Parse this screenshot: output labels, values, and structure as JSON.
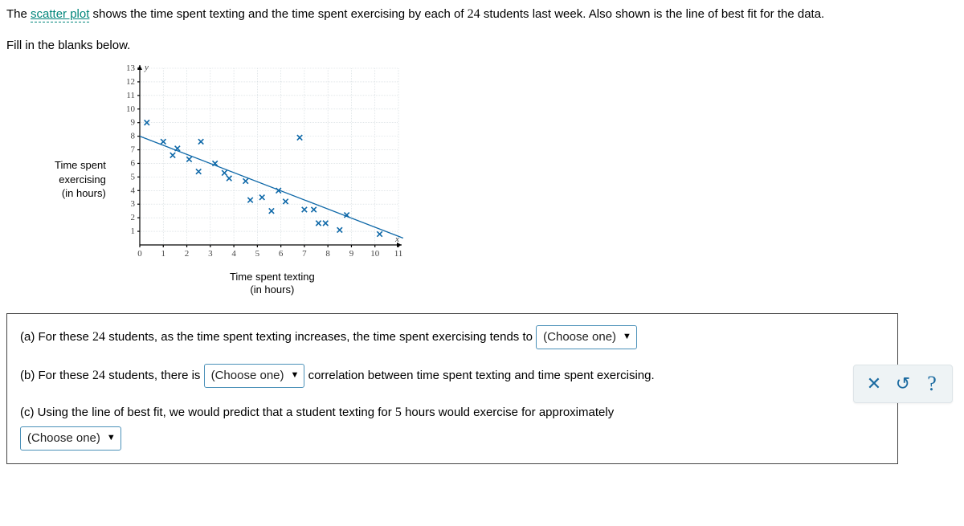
{
  "intro": {
    "prefix": "The ",
    "link_text": "scatter plot",
    "mid1": " shows the time spent texting and the time spent exercising by each of ",
    "count": "24",
    "mid2": " students last week. Also shown is the line of best fit for the data.",
    "line2": "Fill in the blanks below."
  },
  "axis_labels": {
    "y1": "Time spent",
    "y2": "exercising",
    "y3": "(in hours)",
    "x1": "Time spent texting",
    "x2": "(in hours)"
  },
  "questions": {
    "a_pre": "(a) For these ",
    "a_n": "24",
    "a_post": " students, as the time spent texting increases, the time spent exercising tends to ",
    "b_pre": "(b) For these ",
    "b_n": "24",
    "b_mid": " students, there is ",
    "b_post": " correlation between time spent texting and time spent exercising.",
    "c_pre": "(c) Using the line of best fit, we would predict that a student texting for ",
    "c_n": "5",
    "c_post": " hours would exercise for approximately",
    "choose": "(Choose one)"
  },
  "toolbar": {
    "close": "✕",
    "reset": "↺",
    "help": "?"
  },
  "chart_data": {
    "type": "scatter",
    "xlabel": "Time spent texting (in hours)",
    "ylabel": "Time spent exercising (in hours)",
    "xlim": [
      0,
      11
    ],
    "ylim": [
      0,
      13
    ],
    "x_ticks": [
      0,
      1,
      2,
      3,
      4,
      5,
      6,
      7,
      8,
      9,
      10,
      11
    ],
    "y_ticks": [
      0,
      1,
      2,
      3,
      4,
      5,
      6,
      7,
      8,
      9,
      10,
      11,
      12,
      13
    ],
    "points": [
      {
        "x": 0.3,
        "y": 9.0
      },
      {
        "x": 1.0,
        "y": 7.6
      },
      {
        "x": 1.4,
        "y": 6.6
      },
      {
        "x": 1.6,
        "y": 7.1
      },
      {
        "x": 2.1,
        "y": 6.3
      },
      {
        "x": 2.5,
        "y": 5.4
      },
      {
        "x": 2.6,
        "y": 7.6
      },
      {
        "x": 3.2,
        "y": 6.0
      },
      {
        "x": 3.6,
        "y": 5.3
      },
      {
        "x": 3.8,
        "y": 4.9
      },
      {
        "x": 4.5,
        "y": 4.7
      },
      {
        "x": 4.7,
        "y": 3.3
      },
      {
        "x": 5.2,
        "y": 3.5
      },
      {
        "x": 5.6,
        "y": 2.5
      },
      {
        "x": 5.9,
        "y": 4.0
      },
      {
        "x": 6.2,
        "y": 3.2
      },
      {
        "x": 6.8,
        "y": 7.9
      },
      {
        "x": 7.0,
        "y": 2.6
      },
      {
        "x": 7.4,
        "y": 2.6
      },
      {
        "x": 7.6,
        "y": 1.6
      },
      {
        "x": 7.9,
        "y": 1.6
      },
      {
        "x": 8.5,
        "y": 1.1
      },
      {
        "x": 8.8,
        "y": 2.2
      },
      {
        "x": 10.2,
        "y": 0.8
      }
    ],
    "best_fit": {
      "x1": 0,
      "y1": 8.0,
      "x2": 11.2,
      "y2": 0.5
    }
  }
}
